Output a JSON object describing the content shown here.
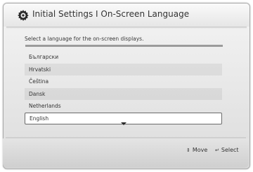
{
  "header": {
    "title": "Initial Settings I On-Screen Language",
    "icon": "gear-icon"
  },
  "instruction": "Select a language for the on-screen displays.",
  "languages": [
    {
      "label": "Български",
      "selected": false
    },
    {
      "label": "Hrvatski",
      "selected": false
    },
    {
      "label": "Čeština",
      "selected": false
    },
    {
      "label": "Dansk",
      "selected": false
    },
    {
      "label": "Netherlands",
      "selected": false
    },
    {
      "label": "English",
      "selected": true
    }
  ],
  "scroll_indicator": "down-arrow-icon",
  "footer": {
    "move": {
      "icon": "up-down-arrows-icon",
      "label": "Move"
    },
    "select": {
      "icon": "enter-icon",
      "label": "Select"
    }
  }
}
